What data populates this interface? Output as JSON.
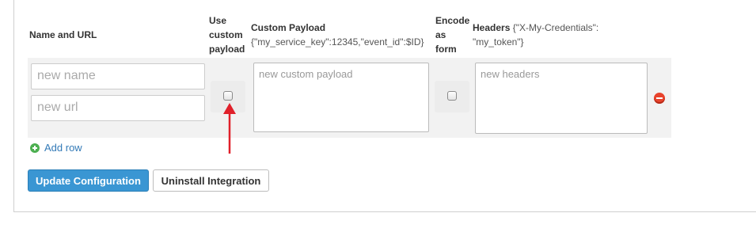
{
  "headers": {
    "name_url": "Name and URL",
    "use_custom_payload_line1": "Use",
    "use_custom_payload_line2": "custom",
    "use_custom_payload_line3": "payload",
    "custom_payload": "Custom Payload",
    "custom_payload_example": "{\"my_service_key\":12345,\"event_id\":$ID}",
    "encode_line1": "Encode",
    "encode_line2": "as",
    "encode_line3": "form",
    "headers_title": "Headers",
    "headers_example_line1": "{\"X-My-Credentials\":",
    "headers_example_line2": "\"my_token\"}"
  },
  "row": {
    "name_placeholder": "new name",
    "url_placeholder": "new url",
    "custom_payload_placeholder": "new custom payload",
    "headers_placeholder": "new headers",
    "use_custom_payload_checked": false,
    "encode_as_form_checked": false
  },
  "add_row_label": "Add row",
  "buttons": {
    "update": "Update Configuration",
    "uninstall": "Uninstall Integration"
  },
  "colors": {
    "primary": "#3a96d3",
    "link": "#337ab7",
    "remove": "#e8432c",
    "add": "#4caf50",
    "annotation_arrow": "#e0202a"
  }
}
